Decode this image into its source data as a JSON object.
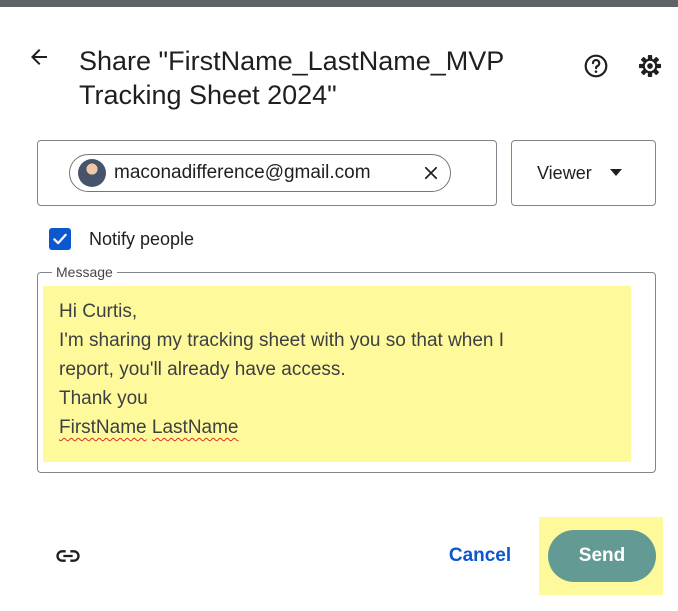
{
  "dialog": {
    "title": "Share \"FirstName_LastName_MVP Tracking Sheet 2024\""
  },
  "icons": {
    "back": "arrow-back-icon",
    "help": "help-icon",
    "settings": "gear-icon",
    "avatar": "avatar",
    "chip_remove": "close-icon",
    "role_dropdown": "caret-down-icon",
    "checkbox": "checkmark-icon",
    "copy_link": "link-icon"
  },
  "recipient": {
    "email": "maconadifference@gmail.com"
  },
  "role": {
    "selected": "Viewer"
  },
  "notify": {
    "label": "Notify people",
    "checked": true
  },
  "message": {
    "label": "Message",
    "lines": [
      "Hi Curtis,",
      "I'm sharing my tracking sheet with you so that when I",
      "report, you'll already have access.",
      "Thank you"
    ],
    "signature_first": "FirstName",
    "signature_last": "LastName"
  },
  "actions": {
    "cancel": "Cancel",
    "send": "Send"
  },
  "colors": {
    "accent": "#0b57d0",
    "send_button": "#649a94",
    "highlight": "#fefa9c"
  }
}
